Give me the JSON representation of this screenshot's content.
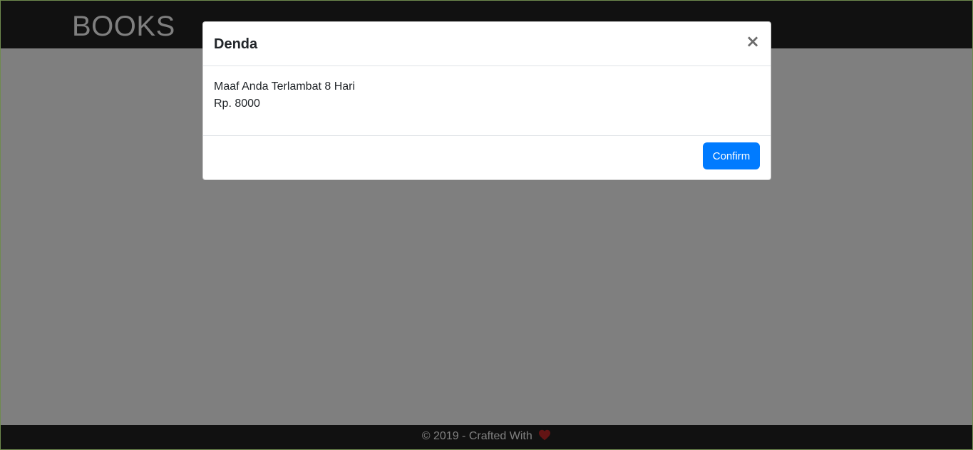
{
  "navbar": {
    "brand": "BOOKS"
  },
  "footer": {
    "text": "© 2019 - Crafted With",
    "icon": "heart-icon",
    "icon_color": "#c62828"
  },
  "modal": {
    "title": "Denda",
    "close_label": "×",
    "message_line1": "Maaf Anda Terlambat 8 Hari",
    "message_line2": "Rp. 8000",
    "confirm_label": "Confirm"
  },
  "colors": {
    "primary": "#007bff",
    "navbar_bg": "#222222"
  }
}
